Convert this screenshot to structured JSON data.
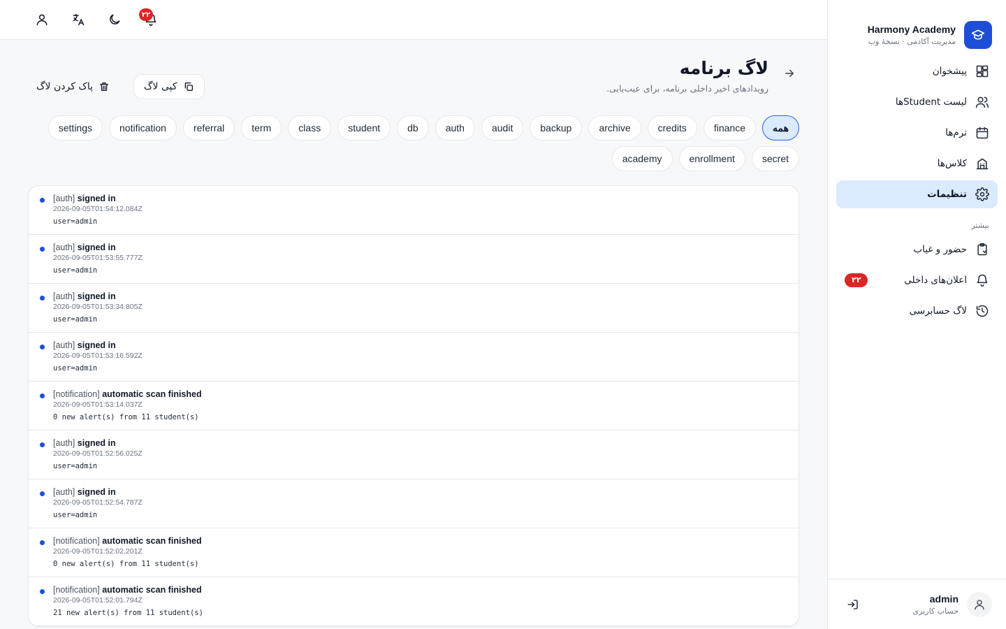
{
  "brand": {
    "name": "Harmony Academy",
    "subtitle": "مدیریت آکادمی · نسخهٔ وب",
    "logo_icon": "graduation-cap-icon",
    "accent": "#1d4ed8"
  },
  "sidebar": {
    "items": [
      {
        "label": "پیشخوان",
        "icon": "dashboard-icon"
      },
      {
        "label": "لیست Studentها",
        "icon": "users-icon"
      },
      {
        "label": "ترم‌ها",
        "icon": "calendar-icon"
      },
      {
        "label": "کلاس‌ها",
        "icon": "building-icon"
      },
      {
        "label": "تنظیمات",
        "icon": "gear-icon",
        "active": true
      }
    ],
    "more_title": "بیشتر",
    "more_items": [
      {
        "label": "حضور و غیاب",
        "icon": "clipboard-icon"
      },
      {
        "label": "اعلان‌های داخلی",
        "icon": "bell-icon",
        "badge": "۲۲"
      },
      {
        "label": "لاگ حسابرسی",
        "icon": "history-icon"
      }
    ]
  },
  "user": {
    "name": "admin",
    "role": "حساب کاربری"
  },
  "topbar": {
    "notifications_badge": "۲۲"
  },
  "page": {
    "title": "لاگ برنامه",
    "subtitle": "رویدادهای اخیر داخلی برنامه، برای عیب‌یابی.",
    "copy_label": "کپی لاگ",
    "clear_label": "پاک کردن لاگ"
  },
  "filters": [
    "همه",
    "finance",
    "credits",
    "archive",
    "backup",
    "audit",
    "auth",
    "db",
    "student",
    "class",
    "term",
    "referral",
    "notification",
    "settings",
    "secret",
    "enrollment",
    "academy"
  ],
  "active_filter": "همه",
  "logs": [
    {
      "tag": "[auth]",
      "message": "signed in",
      "time": "2026-09-05T01:54:12.084Z",
      "detail": "user=admin"
    },
    {
      "tag": "[auth]",
      "message": "signed in",
      "time": "2026-09-05T01:53:55.777Z",
      "detail": "user=admin"
    },
    {
      "tag": "[auth]",
      "message": "signed in",
      "time": "2026-09-05T01:53:34.805Z",
      "detail": "user=admin"
    },
    {
      "tag": "[auth]",
      "message": "signed in",
      "time": "2026-09-05T01:53:16.592Z",
      "detail": "user=admin"
    },
    {
      "tag": "[notification]",
      "message": "automatic scan finished",
      "time": "2026-09-05T01:53:14.037Z",
      "detail": "0 new alert(s) from 11 student(s)"
    },
    {
      "tag": "[auth]",
      "message": "signed in",
      "time": "2026-09-05T01:52:56.025Z",
      "detail": "user=admin"
    },
    {
      "tag": "[auth]",
      "message": "signed in",
      "time": "2026-09-05T01:52:54.787Z",
      "detail": "user=admin"
    },
    {
      "tag": "[notification]",
      "message": "automatic scan finished",
      "time": "2026-09-05T01:52:02.201Z",
      "detail": "0 new alert(s) from 11 student(s)"
    },
    {
      "tag": "[notification]",
      "message": "automatic scan finished",
      "time": "2026-09-05T01:52:01.794Z",
      "detail": "21 new alert(s) from 11 student(s)"
    }
  ]
}
